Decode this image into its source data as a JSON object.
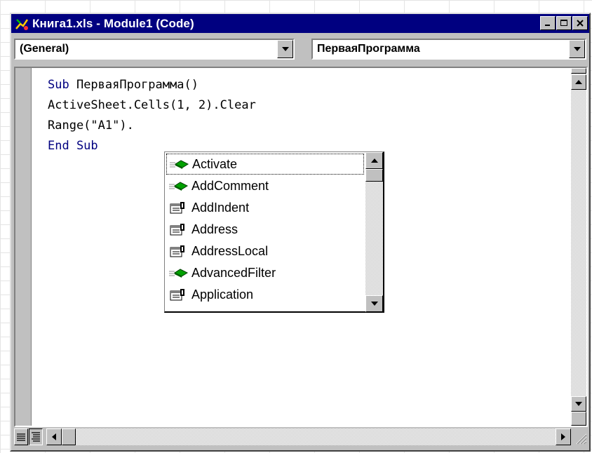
{
  "window": {
    "title": "Книга1.xls - Module1 (Code)",
    "controls": [
      "minimize-icon",
      "maximize-icon",
      "close-icon"
    ]
  },
  "object_combo": {
    "value": "(General)"
  },
  "procedure_combo": {
    "value": "ПерваяПрограмма"
  },
  "code": {
    "lines": [
      {
        "keyword": "Sub",
        "text": " ПерваяПрограмма()"
      },
      {
        "keyword": "",
        "text": "ActiveSheet.Cells(1, 2).Clear"
      },
      {
        "keyword": "",
        "text": "Range(\"A1\")."
      },
      {
        "keyword": "End Sub",
        "text": ""
      }
    ]
  },
  "autocomplete": {
    "selected_index": 0,
    "items": [
      {
        "label": "Activate",
        "icon": "method-icon"
      },
      {
        "label": "AddComment",
        "icon": "method-icon"
      },
      {
        "label": "AddIndent",
        "icon": "property-icon"
      },
      {
        "label": "Address",
        "icon": "property-icon"
      },
      {
        "label": "AddressLocal",
        "icon": "property-icon"
      },
      {
        "label": "AdvancedFilter",
        "icon": "method-icon"
      },
      {
        "label": "Application",
        "icon": "property-icon"
      }
    ]
  },
  "bottom_bar": {
    "view_buttons": [
      "procedure-view-icon",
      "full-module-view-icon"
    ]
  },
  "colors": {
    "titlebar": "#000080",
    "keyword": "#000080",
    "chrome": "#c0c0c0"
  }
}
